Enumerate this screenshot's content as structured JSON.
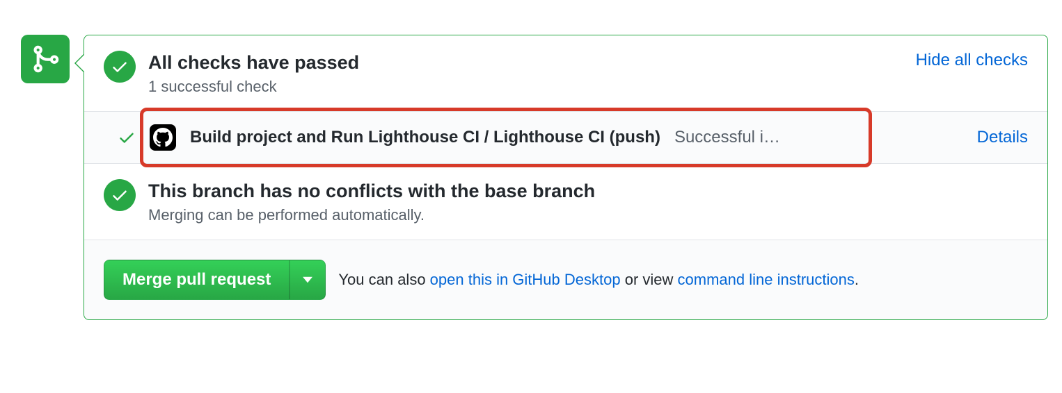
{
  "checks": {
    "title": "All checks have passed",
    "subtitle": "1 successful check",
    "toggle_link": "Hide all checks",
    "items": [
      {
        "name": "Build project and Run Lighthouse CI / Lighthouse CI (push)",
        "status": "Successful i…",
        "details_link": "Details"
      }
    ]
  },
  "conflicts": {
    "title": "This branch has no conflicts with the base branch",
    "subtitle": "Merging can be performed automatically."
  },
  "merge": {
    "button_label": "Merge pull request",
    "help_prefix": "You can also ",
    "desktop_link": "open this in GitHub Desktop",
    "help_mid": " or view ",
    "cli_link": "command line instructions",
    "help_suffix": "."
  }
}
